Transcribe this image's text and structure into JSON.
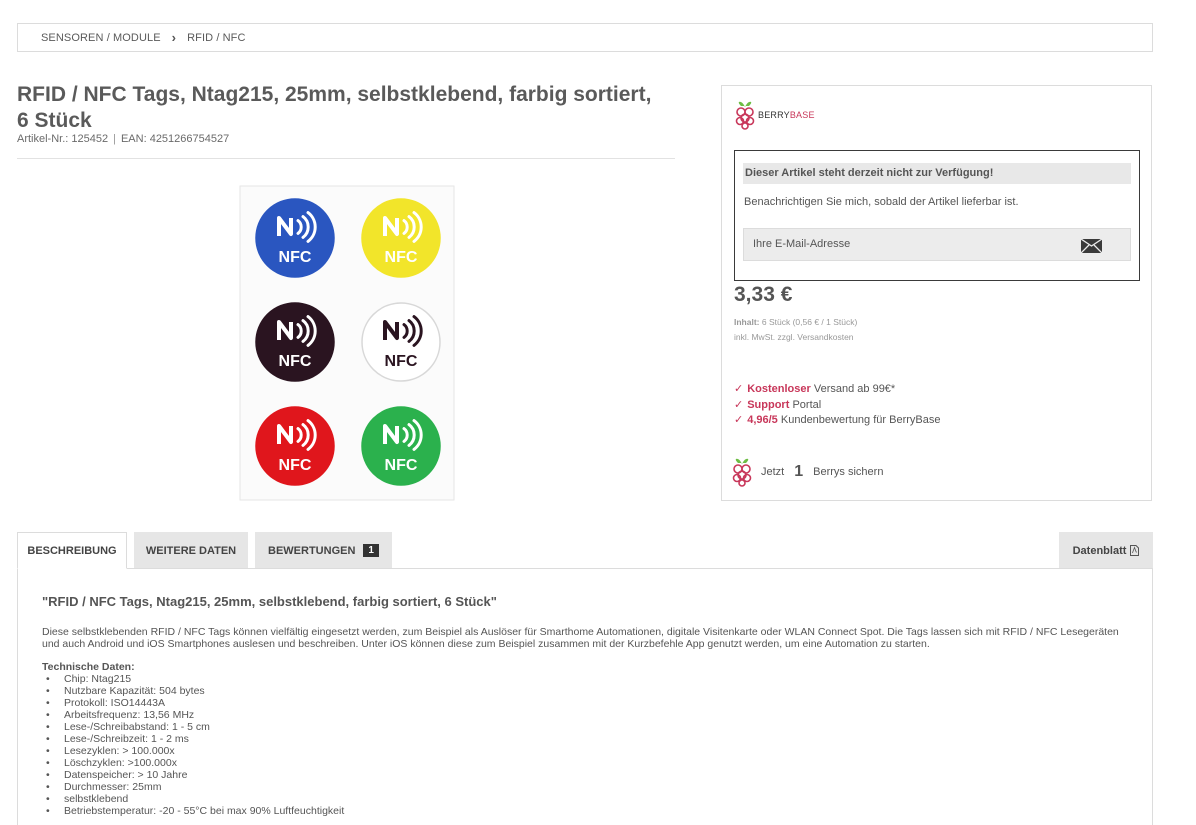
{
  "breadcrumb": {
    "items": [
      "SENSOREN / MODULE",
      "RFID / NFC"
    ]
  },
  "product": {
    "title": "RFID / NFC Tags, Ntag215, 25mm, selbstklebend, farbig sortiert, 6 Stück",
    "article_no": "Artikel-Nr.: 125452",
    "ean": "EAN: 4251266754527",
    "tags": [
      {
        "color": "#2a56c0",
        "text_color": "#ffffff",
        "label": "NFC"
      },
      {
        "color": "#f2e52a",
        "text_color": "#ffffff",
        "label": "NFC"
      },
      {
        "color": "#2a1420",
        "text_color": "#ffffff",
        "label": "NFC"
      },
      {
        "color": "#ffffff",
        "text_color": "#2a1420",
        "label": "NFC"
      },
      {
        "color": "#e0161c",
        "text_color": "#ffffff",
        "label": "NFC"
      },
      {
        "color": "#2bb14d",
        "text_color": "#ffffff",
        "label": "NFC"
      }
    ]
  },
  "buybox": {
    "logo_text_1": "BERRY",
    "logo_text_2": "BASE",
    "notice_title": "Dieser Artikel steht derzeit nicht zur Verfügung!",
    "notice_text": "Benachrichtigen Sie mich, sobald der Artikel lieferbar ist.",
    "email_placeholder": "Ihre E-Mail-Adresse",
    "price": "3,33 €",
    "content_label": "Inhalt:",
    "content_value": "6 Stück (0,56 € / 1 Stück)",
    "tax_note": "inkl. MwSt. zzgl. Versandkosten",
    "usp": [
      {
        "highlight": "Kostenloser",
        "rest": "Versand ab 99€*"
      },
      {
        "highlight": "Support",
        "rest": "Portal"
      },
      {
        "highlight": "4,96/5",
        "rest": "Kundenbewertung für BerryBase"
      }
    ],
    "berrys_prefix": "Jetzt",
    "berrys_count": "1",
    "berrys_suffix": "Berrys sichern"
  },
  "tabs": {
    "description": "BESCHREIBUNG",
    "details": "WEITERE DATEN",
    "reviews": "BEWERTUNGEN",
    "reviews_count": "1",
    "datasheet": "Datenblatt"
  },
  "description": {
    "title": "\"RFID / NFC Tags, Ntag215, 25mm, selbstklebend, farbig sortiert, 6 Stück\"",
    "text": "Diese selbstklebenden RFID / NFC Tags können vielfältig eingesetzt werden, zum Beispiel als Auslöser für Smarthome Automationen, digitale Visitenkarte oder WLAN Connect Spot. Die Tags lassen sich mit RFID / NFC Lesegeräten und auch Android und iOS Smartphones auslesen und beschreiben. Unter iOS können diese zum Beispiel zusammen mit der Kurzbefehle App genutzt werden, um eine Automation zu starten.",
    "tech_heading": "Technische Daten:",
    "tech_items": [
      "Chip: Ntag215",
      "Nutzbare Kapazität: 504 bytes",
      "Protokoll: ISO14443A",
      "Arbeitsfrequenz: 13,56 MHz",
      "Lese-/Schreibabstand: 1 - 5 cm",
      "Lese-/Schreibzeit: 1 - 2 ms",
      "Lesezyklen: > 100.000x",
      "Löschzyklen: >100.000x",
      "Datenspeicher: > 10 Jahre",
      "Durchmesser: 25mm",
      "selbstklebend",
      "Betriebstemperatur: -20 - 55°C bei max 90% Luftfeuchtigkeit"
    ]
  }
}
